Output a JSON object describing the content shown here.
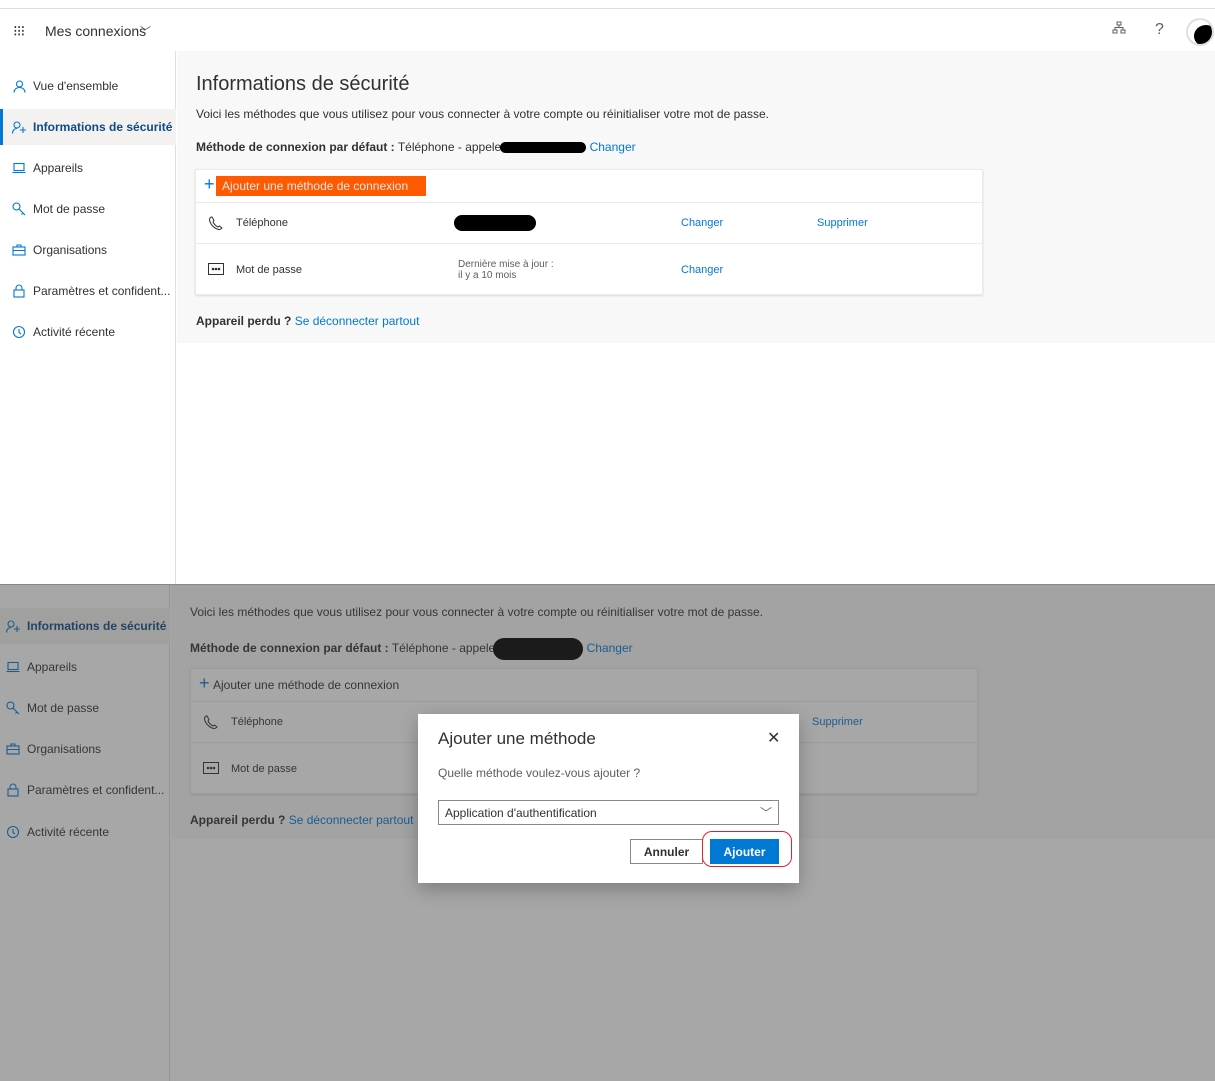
{
  "header": {
    "app_name": "Mes connexions"
  },
  "sidebar": {
    "items": [
      {
        "label": "Vue d'ensemble"
      },
      {
        "label": "Informations de sécurité"
      },
      {
        "label": "Appareils"
      },
      {
        "label": "Mot de passe"
      },
      {
        "label": "Organisations"
      },
      {
        "label": "Paramètres et confident..."
      },
      {
        "label": "Activité récente"
      }
    ]
  },
  "main": {
    "title": "Informations de sécurité",
    "description": "Voici les méthodes que vous utilisez pour vous connecter à votre compte ou réinitialiser votre mot de passe.",
    "default_method_label": "Méthode de connexion par défaut :",
    "default_method_value": "Téléphone - appeler",
    "default_method_change": "Changer",
    "add_method": "Ajouter une méthode de connexion",
    "methods": [
      {
        "name": "Téléphone",
        "change": "Changer",
        "delete": "Supprimer"
      },
      {
        "name": "Mot de passe",
        "info_line1": "Dernière mise à jour :",
        "info_line2": "il y a 10 mois",
        "change": "Changer"
      }
    ],
    "lost_device_label": "Appareil perdu ?",
    "lost_device_link": "Se déconnecter partout"
  },
  "dialog": {
    "title": "Ajouter une méthode",
    "question": "Quelle méthode voulez-vous ajouter ?",
    "selected_option": "Application d'authentification",
    "cancel": "Annuler",
    "confirm": "Ajouter"
  },
  "colors": {
    "accent": "#0078d4",
    "highlight": "#ff5a00",
    "annotation": "#e0232a"
  }
}
